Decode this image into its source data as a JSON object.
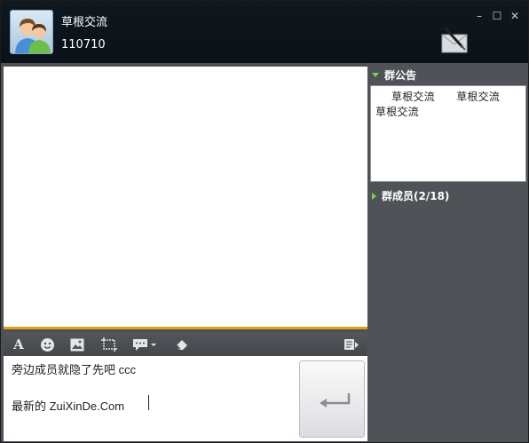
{
  "header": {
    "group_name": "草根交流",
    "group_id": "110710",
    "window_controls": {
      "minimize": "–",
      "maximize": "☐",
      "close": "✕"
    }
  },
  "toolbar": {
    "icons": [
      "font-icon",
      "emoji-icon",
      "image-icon",
      "screenshot-icon",
      "quick-reply-icon",
      "clear-icon",
      "history-icon"
    ],
    "font_label": "A"
  },
  "input": {
    "line1": "旁边成员就隐了先吧 ccc",
    "line2": "最新的 ZuiXinDe.Com"
  },
  "send_button": {
    "icon": "enter-icon"
  },
  "sidebar": {
    "announcement_title": "群公告",
    "announcement_text": "草根交流　　草根交流　　草根交流",
    "members_title": "群成员(2/18)"
  },
  "colors": {
    "titlebar": "#0c141b",
    "panel": "#4f5257",
    "accent_line": "#e0a21b",
    "triangle": "#7bd34a"
  }
}
